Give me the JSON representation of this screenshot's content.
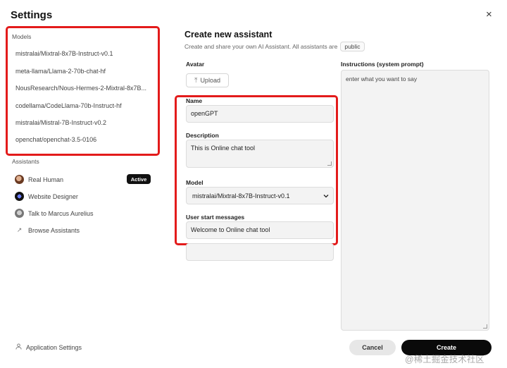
{
  "header": {
    "title": "Settings",
    "close_glyph": "×"
  },
  "sidebar": {
    "models_label": "Models",
    "models": [
      "mistralai/Mixtral-8x7B-Instruct-v0.1",
      "meta-llama/Llama-2-70b-chat-hf",
      "NousResearch/Nous-Hermes-2-Mixtral-8x7B...",
      "codellama/CodeLlama-70b-Instruct-hf",
      "mistralai/Mistral-7B-Instruct-v0.2",
      "openchat/openchat-3.5-0106"
    ],
    "assistants_label": "Assistants",
    "assistants": [
      {
        "label": "Real Human",
        "badge": "Active"
      },
      {
        "label": "Website Designer"
      },
      {
        "label": "Talk to Marcus Aurelius"
      },
      {
        "label": "Browse Assistants"
      }
    ],
    "app_settings": "Application Settings"
  },
  "form": {
    "title": "Create new assistant",
    "subtitle": "Create and share your own AI Assistant. All assistants are",
    "visibility": "public",
    "avatar_label": "Avatar",
    "upload_label": "Upload",
    "name_label": "Name",
    "name_value": "openGPT",
    "description_label": "Description",
    "description_value": "This is Online chat tool",
    "model_label": "Model",
    "model_value": "mistralai/Mixtral-8x7B-Instruct-v0.1",
    "start_messages_label": "User start messages",
    "start_message_1": "Welcome to Online chat tool",
    "start_message_2": "",
    "instructions_label": "Instructions (system prompt)",
    "instructions_value": "enter what you want to say",
    "cancel_label": "Cancel",
    "create_label": "Create"
  },
  "watermark": "@稀土掘金技术社区",
  "colors": {
    "highlight": "#e31b1b",
    "primary": "#0a0a0a"
  }
}
